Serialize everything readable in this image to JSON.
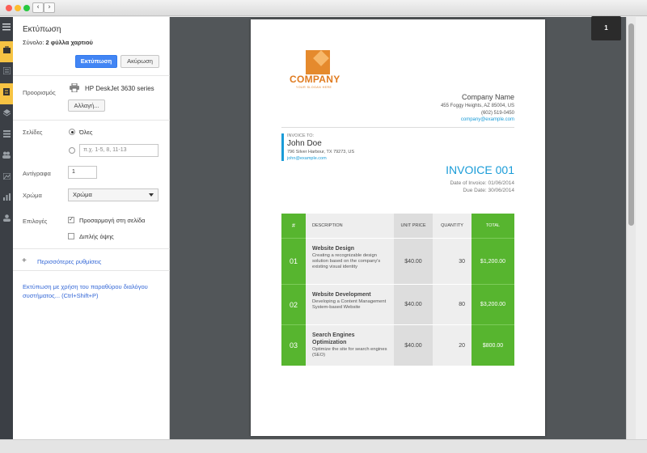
{
  "window": {
    "nav_back": "‹",
    "nav_forward": "›"
  },
  "rail": {
    "items": [
      "menu-icon",
      "suitcase-icon",
      "list-icon",
      "document-icon",
      "layers-icon",
      "stack-icon",
      "people-icon",
      "image-icon",
      "chart-icon",
      "user-icon"
    ]
  },
  "print_dialog": {
    "title": "Εκτύπωση",
    "total_label": "Σύνολο:",
    "total_value": "2 φύλλα χαρτιού",
    "print_button": "Εκτύπωση",
    "cancel_button": "Ακύρωση",
    "destination_label": "Προορισμός",
    "printer_name": "HP DeskJet 3630 series",
    "change_button": "Αλλαγή...",
    "pages_label": "Σελίδες",
    "pages_all": "Όλες",
    "pages_range_placeholder": "π.χ. 1-5, 8, 11-13",
    "copies_label": "Αντίγραφα",
    "copies_value": "1",
    "color_label": "Χρώμα",
    "color_value": "Χρώμα",
    "options_label": "Επιλογές",
    "option_fit": "Προσαρμογή στη σελίδα",
    "option_fit_checked": true,
    "option_duplex": "Διπλής όψης",
    "option_duplex_checked": false,
    "more_settings": "Περισσότερες ρυθμίσεις",
    "system_dialog_link": "Εκτύπωση με χρήση του παραθύρου διαλόγου συστήματος... (Ctrl+Shift+P)"
  },
  "preview": {
    "page_indicator": "1"
  },
  "invoice": {
    "logo_text": "COMPANY",
    "logo_tagline": "YOUR SLOGAN HERE",
    "company_name": "Company Name",
    "company_address": "455 Foggy Heights, AZ 85004, US",
    "company_phone": "(602) 519-0450",
    "company_email": "company@example.com",
    "bill_label": "INVOICE TO:",
    "client_name": "John Doe",
    "client_address": "796 Silver Harbour, TX 79273, US",
    "client_email": "john@example.com",
    "invoice_title": "INVOICE 001",
    "invoice_date": "Date of Invoice: 01/06/2014",
    "due_date": "Due Date: 30/06/2014",
    "columns": [
      "#",
      "DESCRIPTION",
      "UNIT PRICE",
      "QUANTITY",
      "TOTAL"
    ],
    "items": [
      {
        "num": "01",
        "name": "Website Design",
        "desc": "Creating a recognizable design solution based on the company's existing visual identity",
        "price": "$40.00",
        "qty": "30",
        "total": "$1,200.00"
      },
      {
        "num": "02",
        "name": "Website Development",
        "desc": "Developing a Content Management System-based Website",
        "price": "$40.00",
        "qty": "80",
        "total": "$3,200.00"
      },
      {
        "num": "03",
        "name": "Search Engines Optimization",
        "desc": "Optimize the site for search engines (SEO)",
        "price": "$40.00",
        "qty": "20",
        "total": "$800.00"
      }
    ]
  },
  "colors": {
    "accent_green": "#57b52f",
    "accent_blue": "#1a9cd8",
    "brand_orange": "#e07b1f",
    "print_button": "#4285f4"
  }
}
